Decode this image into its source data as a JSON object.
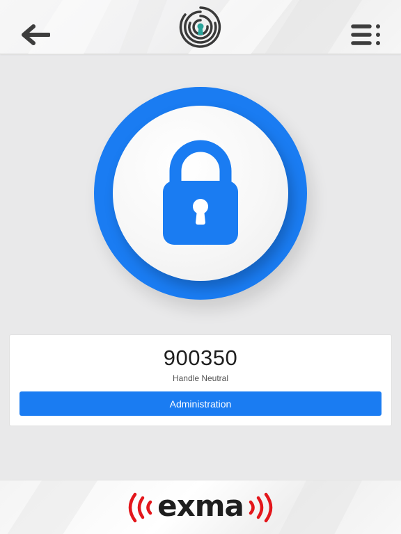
{
  "colors": {
    "accent": "#1a7cf2",
    "brand_red": "#e3161b",
    "icon_dark": "#3d3d3d",
    "keyhole_teal": "#2aa39a",
    "background": "#e9e9ea"
  },
  "header": {
    "back_icon": "arrow-left-icon",
    "logo_icon": "fingerprint-keyhole-logo",
    "menu_icon": "list-menu-icon"
  },
  "lock": {
    "state_icon": "padlock-closed-icon"
  },
  "device": {
    "id": "900350",
    "status": "Handle Neutral",
    "admin_label": "Administration"
  },
  "footer": {
    "brand": "exma"
  }
}
